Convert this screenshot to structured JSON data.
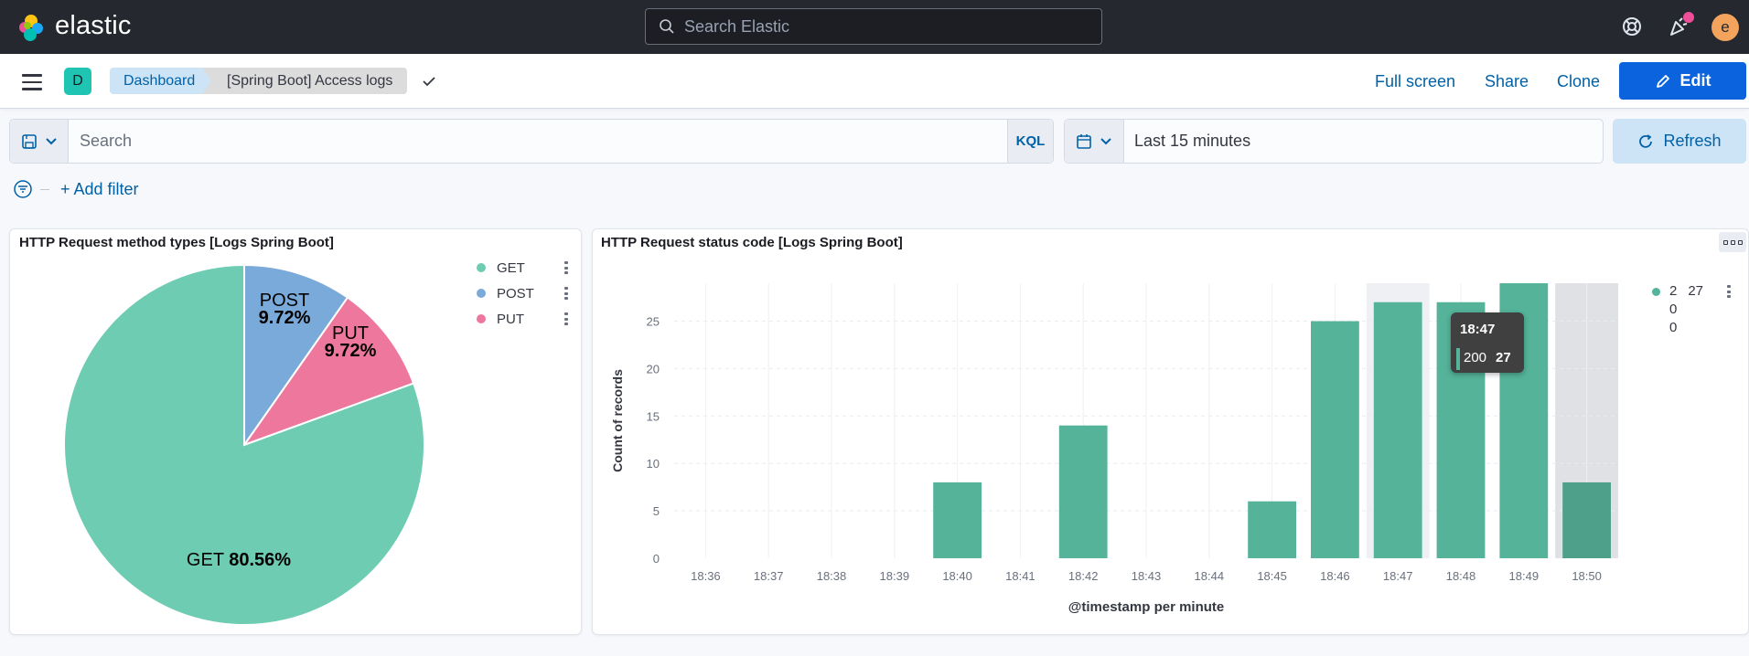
{
  "header": {
    "brand": "elastic",
    "search_placeholder": "Search Elastic",
    "avatar_letter": "e",
    "icons": [
      "elastic-logo-icon",
      "search-icon",
      "help-icon",
      "newsfeed-icon"
    ]
  },
  "navbar": {
    "space_letter": "D",
    "breadcrumbs": [
      "Dashboard",
      "[Spring Boot] Access logs"
    ],
    "full_screen": "Full screen",
    "share": "Share",
    "clone": "Clone",
    "edit": "Edit"
  },
  "query": {
    "search_placeholder": "Search",
    "language": "KQL",
    "time_range": "Last 15 minutes",
    "refresh": "Refresh",
    "add_filter": "+ Add filter"
  },
  "colors": {
    "get": "#6dccb1",
    "post": "#79aad9",
    "put": "#ee789d",
    "bar": "#54b399",
    "accent": "#0b64dd"
  },
  "panels": {
    "pie_title": "HTTP Request method types [Logs Spring Boot]",
    "bar_title": "HTTP Request status code [Logs Spring Boot]",
    "bar_legend": {
      "name": "2",
      "value": "27",
      "extra": [
        "0",
        "0"
      ]
    }
  },
  "tooltip": {
    "time": "18:47",
    "label": "200",
    "value": "27"
  },
  "chart_data": [
    {
      "type": "pie",
      "title": "HTTP Request method types [Logs Spring Boot]",
      "categories": [
        "GET",
        "POST",
        "PUT"
      ],
      "values": [
        80.56,
        9.72,
        9.72
      ],
      "labels": [
        "GET 80.56%",
        "POST 9.72%",
        "PUT 9.72%"
      ],
      "legend": "top-right"
    },
    {
      "type": "bar",
      "title": "HTTP Request status code [Logs Spring Boot]",
      "xlabel": "@timestamp per minute",
      "ylabel": "Count of records",
      "categories": [
        "18:36",
        "18:37",
        "18:38",
        "18:39",
        "18:40",
        "18:41",
        "18:42",
        "18:43",
        "18:44",
        "18:45",
        "18:46",
        "18:47",
        "18:48",
        "18:49",
        "18:50"
      ],
      "series": [
        {
          "name": "200",
          "values": [
            0,
            0,
            0,
            0,
            8,
            0,
            14,
            0,
            0,
            6,
            25,
            27,
            27,
            29,
            8
          ]
        }
      ],
      "yticks": [
        0,
        5,
        10,
        15,
        20,
        25
      ],
      "ylim": [
        0,
        29
      ],
      "grid": true,
      "legend": "top-right"
    }
  ]
}
